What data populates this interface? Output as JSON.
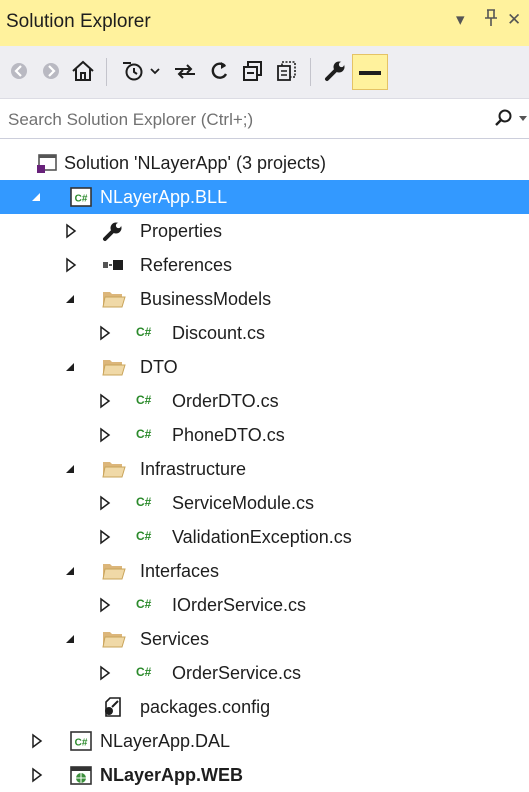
{
  "panel": {
    "title": "Solution Explorer",
    "dropdown_glyph": "▾",
    "pin_glyph": "ꟷ",
    "close_glyph": "✕"
  },
  "toolbar": {
    "buttons": [
      "back-icon",
      "forward-icon",
      "home-icon",
      "history-icon",
      "sync-icon",
      "refresh-icon",
      "collapse-all-icon",
      "show-all-files-icon",
      "properties-wrench-icon",
      "preview-selected-icon"
    ]
  },
  "search": {
    "placeholder": "Search Solution Explorer (Ctrl+;)",
    "value": ""
  },
  "tree": {
    "solution": "Solution 'NLayerApp' (3 projects)",
    "bll": "NLayerApp.BLL",
    "properties": "Properties",
    "references": "References",
    "businessmodels": "BusinessModels",
    "discount": "Discount.cs",
    "dto": "DTO",
    "orderdto": "OrderDTO.cs",
    "phonedto": "PhoneDTO.cs",
    "infrastructure": "Infrastructure",
    "servicemodule": "ServiceModule.cs",
    "validationexception": "ValidationException.cs",
    "interfaces": "Interfaces",
    "iorderservice": "IOrderService.cs",
    "services": "Services",
    "orderservice": "OrderService.cs",
    "packages": "packages.config",
    "dal": "NLayerApp.DAL",
    "web": "NLayerApp.WEB",
    "cs_badge": "C#"
  },
  "colors": {
    "accent_yellow": "#fff29d",
    "selection_blue": "#3399ff",
    "folder": "#dcb67a",
    "csharp_green": "#2b8a2b"
  }
}
